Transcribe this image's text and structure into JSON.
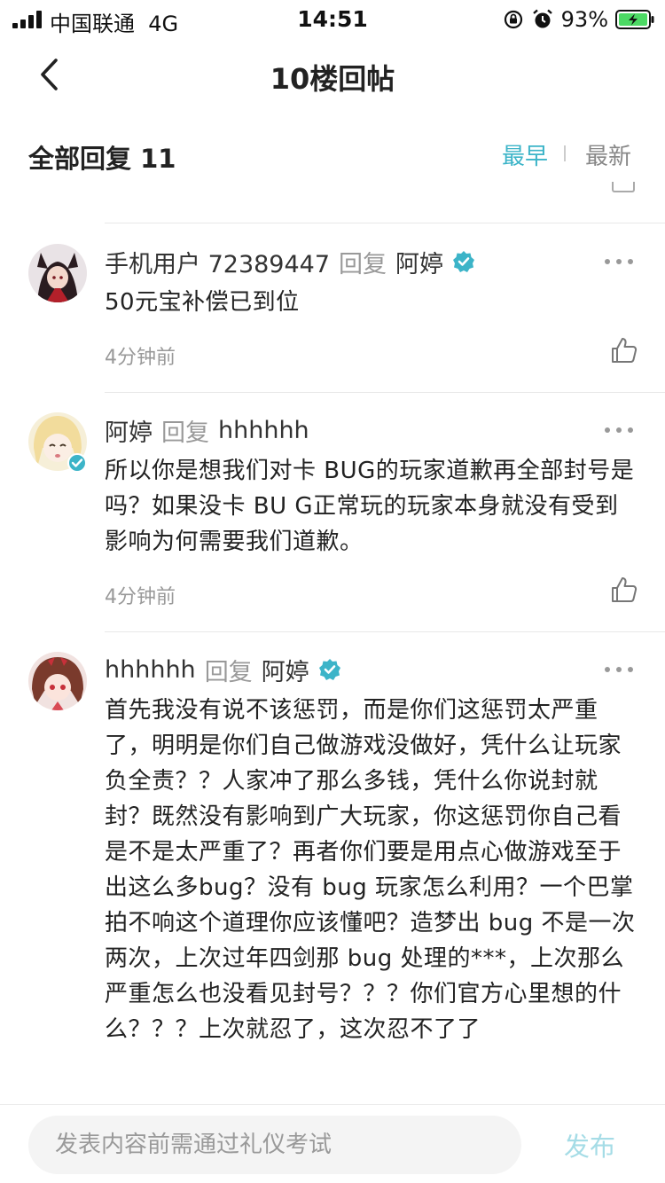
{
  "status": {
    "carrier": "中国联通",
    "network": "4G",
    "time": "14:51",
    "battery": "93%"
  },
  "nav": {
    "title": "10楼回帖"
  },
  "filter": {
    "title": "全部回复 11",
    "earliest": "最早",
    "latest": "最新"
  },
  "comments": [
    {
      "user": "手机用户 72389447",
      "reply_word": "回复",
      "target": "阿婷",
      "target_verified": true,
      "user_verified": false,
      "body": "50元宝补偿已到位",
      "time": "4分钟前"
    },
    {
      "user": "阿婷",
      "reply_word": "回复",
      "target": "hhhhhh",
      "target_verified": false,
      "user_verified": true,
      "body": "所以你是想我们对卡 BUG的玩家道歉再全部封号是吗？如果没卡 BU G正常玩的玩家本身就没有受到影响为何需要我们道歉。",
      "time": "4分钟前"
    },
    {
      "user": "hhhhhh",
      "reply_word": "回复",
      "target": "阿婷",
      "target_verified": true,
      "user_verified": false,
      "body": "首先我没有说不该惩罚，而是你们这惩罚太严重了，明明是你们自己做游戏没做好，凭什么让玩家负全责？？人家冲了那么多钱，凭什么你说封就封？既然没有影响到广大玩家，你这惩罚你自己看是不是太严重了？再者你们要是用点心做游戏至于出这么多bug？没有 bug 玩家怎么利用？一个巴掌拍不响这个道理你应该懂吧？造梦出 bug 不是一次两次，上次过年四剑那 bug 处理的***，上次那么严重怎么也没看见封号？？？你们官方心里想的什么？？？上次就忍了，这次忍不了了",
      "time": ""
    }
  ],
  "composer": {
    "placeholder": "发表内容前需通过礼仪考试",
    "send": "发布"
  },
  "colors": {
    "accent": "#3cb4c8",
    "send_disabled": "#a5dce6"
  }
}
